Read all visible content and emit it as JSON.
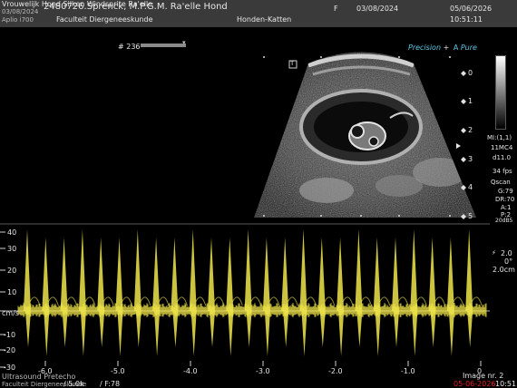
{
  "header": {
    "patient_line": "Vrouwelijk Hond Silken Windsprite Ra'elle",
    "dob_small": "03/08/2024",
    "id_name": "2480726.Sprenck, M.P.G.M. Ra'elle Hond",
    "sex": "F",
    "dob": "03/08/2024",
    "date": "05/06/2026",
    "time": "10:51:11",
    "aplio": "Aplio i700",
    "department": "Faculteit Diergeneeskunde",
    "exam": "Honden-Katten"
  },
  "frame_counter": "# 236",
  "probe_mark": "T",
  "precision": "Precision",
  "precision_plus": "+",
  "apure": "A",
  "apure_text": "Pure",
  "depth_marks": [
    "0",
    "1",
    "2",
    "3",
    "4",
    "5"
  ],
  "right_params": {
    "mi": "MI:(1,1)",
    "probe": "11MC4",
    "depth": "d11.0",
    "fps": "34 fps",
    "mode": "Qscan",
    "gain": "G:79",
    "dr": "DR:70",
    "a": "A:1",
    "p": "P:2",
    "extra": "20dB5"
  },
  "doppler_params": {
    "line1": "2.0",
    "line2": "0°",
    "line3": "2.0cm"
  },
  "y_unit": "cm/s",
  "y_ticks": [
    "40",
    "30",
    "20",
    "10",
    "0",
    "-10",
    "-20",
    "-30"
  ],
  "x_ticks": [
    "-6.0",
    "-5.0",
    "-4.0",
    "-3.0",
    "-2.0",
    "-1.0",
    "0"
  ],
  "footer": {
    "left1": "Ultrasound Pretecho",
    "left2": "Faculteit Diergeneeskunde",
    "prf": "/ 5.0k",
    "filter": "/ F:78",
    "image_nr": "Image nr. 2",
    "date_red": "05-06-2026",
    "time": "10:51"
  },
  "colors": {
    "header_bg": "#3a3a3a",
    "waveform": "#f0e64a",
    "accent": "#5fc8e6",
    "date_red": "#e02020"
  }
}
